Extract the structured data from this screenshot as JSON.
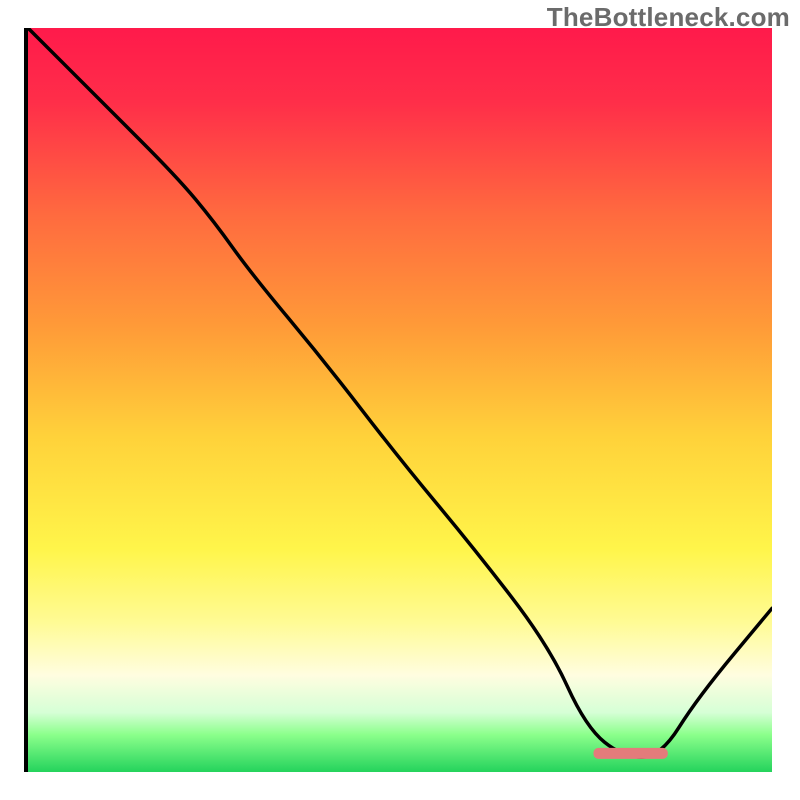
{
  "watermark": "TheBottleneck.com",
  "chart_data": {
    "type": "line",
    "title": "",
    "xlabel": "",
    "ylabel": "",
    "xlim": [
      0,
      100
    ],
    "ylim": [
      0,
      100
    ],
    "gradient_stops": [
      {
        "offset": 0,
        "color": "#ff1a4b"
      },
      {
        "offset": 10,
        "color": "#ff2e49"
      },
      {
        "offset": 25,
        "color": "#ff6a3f"
      },
      {
        "offset": 40,
        "color": "#ff9a38"
      },
      {
        "offset": 55,
        "color": "#ffd23a"
      },
      {
        "offset": 70,
        "color": "#fff54a"
      },
      {
        "offset": 80,
        "color": "#fffb96"
      },
      {
        "offset": 87,
        "color": "#fffde0"
      },
      {
        "offset": 92,
        "color": "#d6ffd6"
      },
      {
        "offset": 95,
        "color": "#8bff8b"
      },
      {
        "offset": 100,
        "color": "#24d35c"
      }
    ],
    "series": [
      {
        "name": "bottleneck-curve",
        "x": [
          0,
          10,
          20,
          25,
          30,
          40,
          50,
          60,
          70,
          75,
          80,
          85,
          90,
          100
        ],
        "y": [
          100,
          90,
          80,
          74,
          67,
          55,
          42,
          30,
          17,
          6,
          2,
          2,
          10,
          22
        ]
      }
    ],
    "marker": {
      "name": "optimal-range-bar",
      "x_start": 76,
      "x_end": 86,
      "y": 2.5,
      "color": "#e37b7b"
    }
  }
}
